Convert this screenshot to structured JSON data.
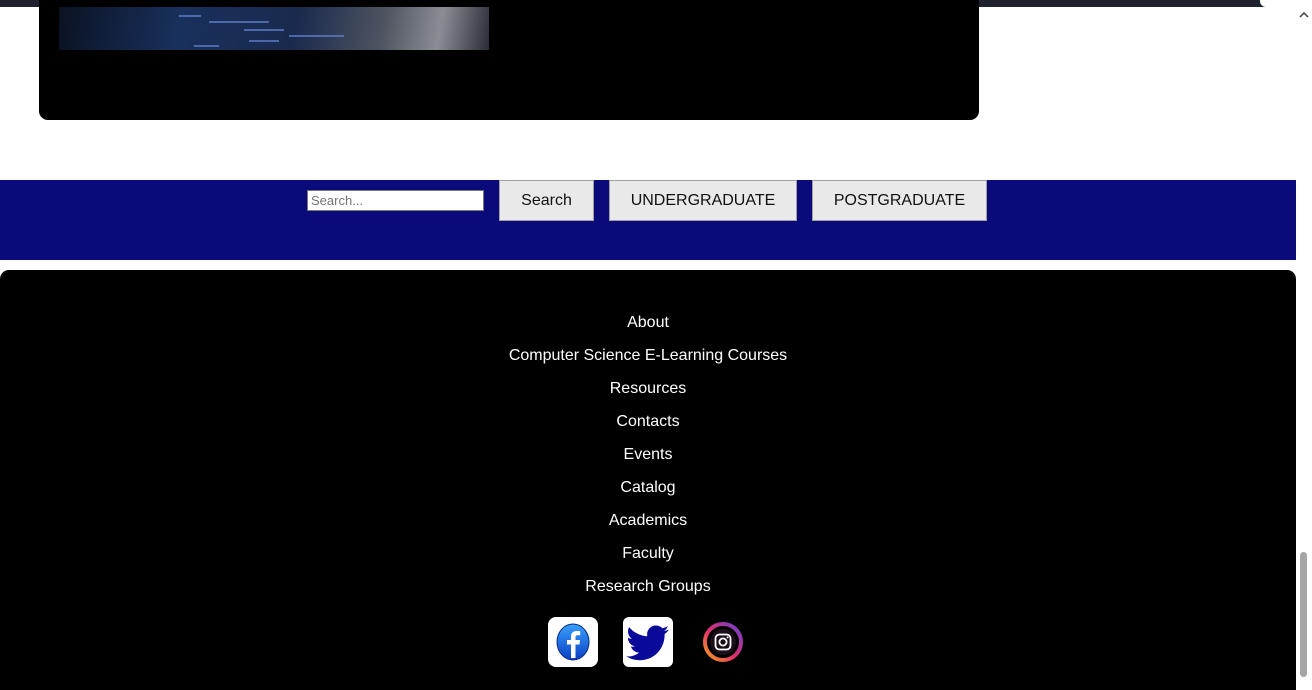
{
  "search": {
    "placeholder": "Search...",
    "button_label": "Search"
  },
  "programs": {
    "undergraduate_label": "UNDERGRADUATE",
    "postgraduate_label": "POSTGRADUATE"
  },
  "footer": {
    "links": [
      "About",
      "Computer Science E-Learning Courses",
      "Resources",
      "Contacts",
      "Events",
      "Catalog",
      "Academics",
      "Faculty",
      "Research Groups"
    ],
    "social": [
      {
        "name": "facebook",
        "icon": "facebook-icon"
      },
      {
        "name": "twitter",
        "icon": "twitter-icon"
      },
      {
        "name": "instagram",
        "icon": "instagram-icon"
      }
    ]
  },
  "colors": {
    "searchbar_bg": "#0a0a7a",
    "footer_bg": "#000000",
    "facebook_blue": "#1877f2",
    "twitter_blue": "#0a0a9a"
  }
}
